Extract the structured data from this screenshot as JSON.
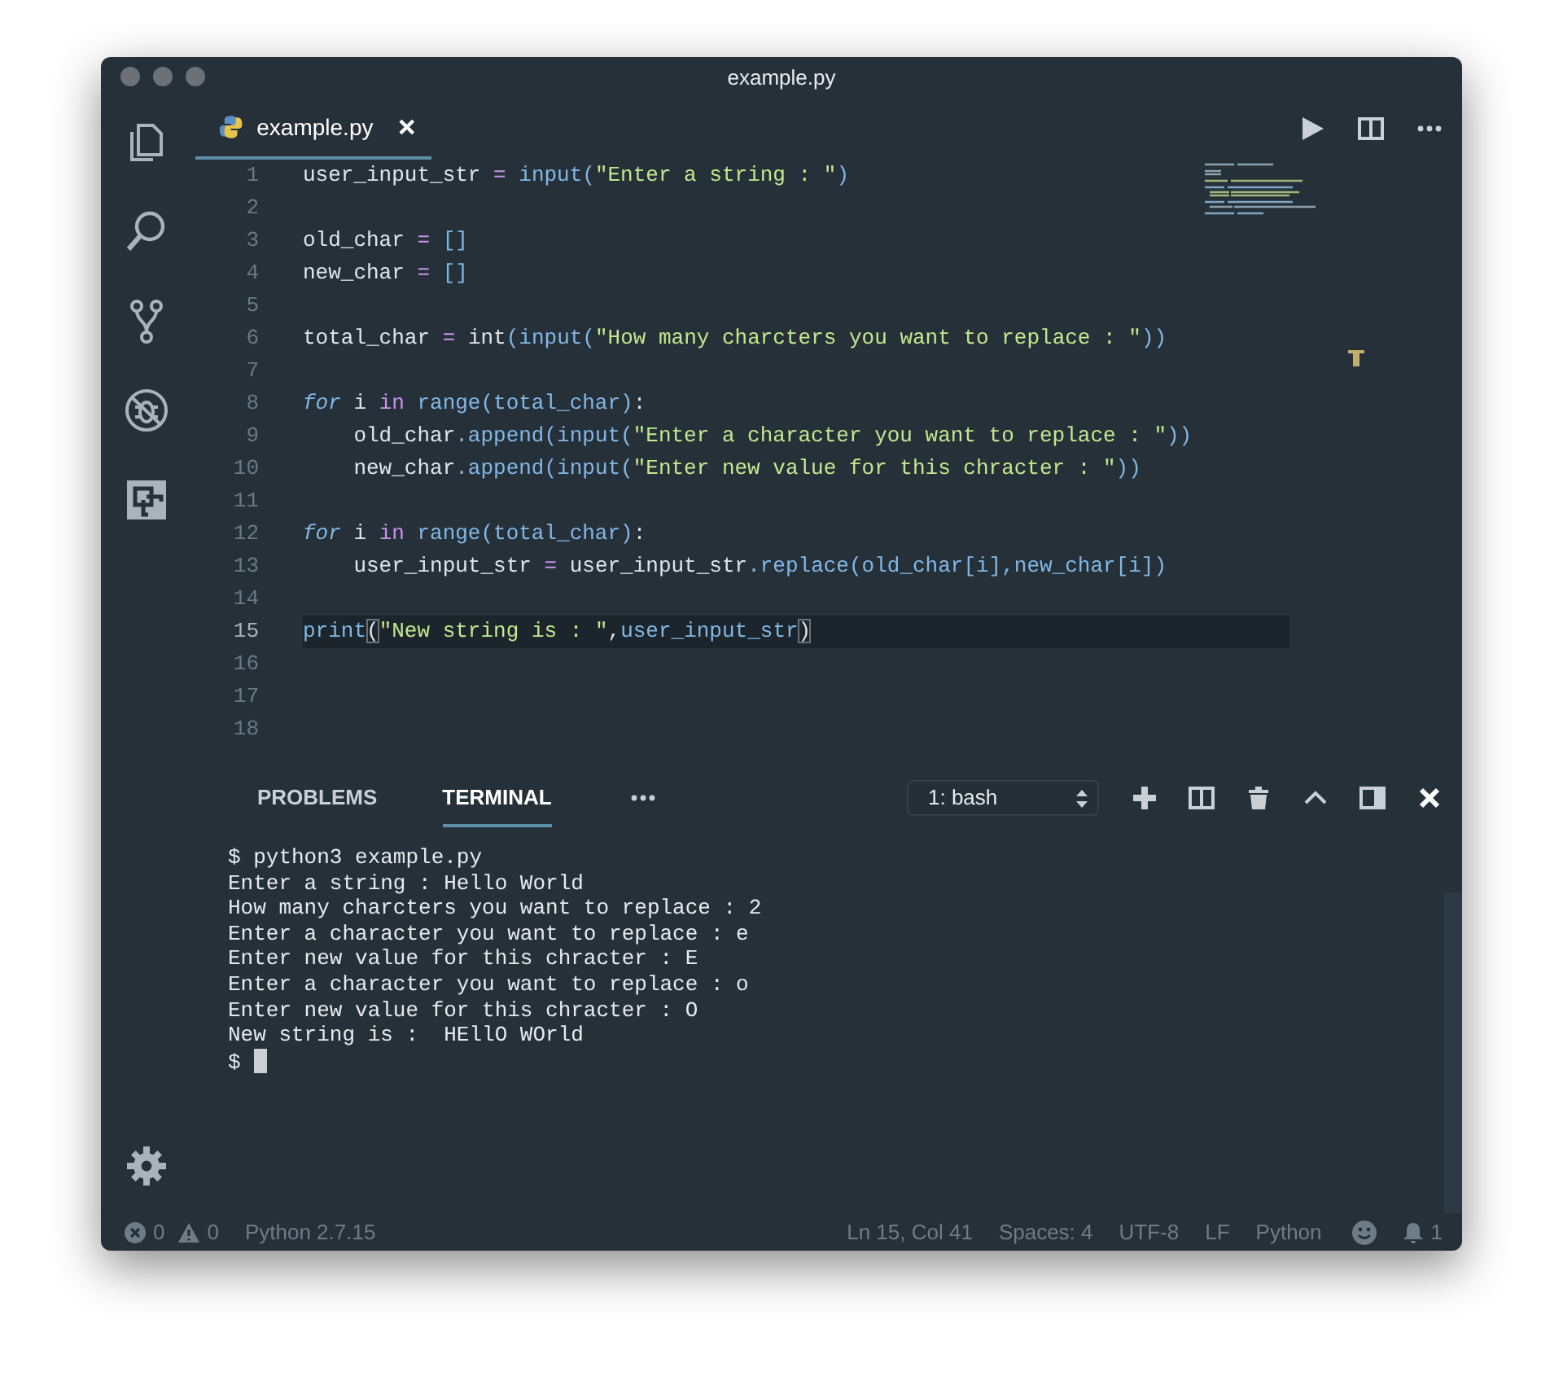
{
  "window": {
    "title": "example.py"
  },
  "tabs": [
    {
      "label": "example.py",
      "selected": true
    }
  ],
  "editor": {
    "lines": [
      {
        "number": "1",
        "current": false,
        "tokens": [
          {
            "text": "user_input_str ",
            "kind": "plain"
          },
          {
            "text": "= ",
            "kind": "operator"
          },
          {
            "text": "input(",
            "kind": "func"
          },
          {
            "text": "\"Enter a string : \"",
            "kind": "string"
          },
          {
            "text": ")",
            "kind": "func"
          }
        ]
      },
      {
        "number": "2",
        "current": false
      },
      {
        "number": "3",
        "current": false,
        "tokens": [
          {
            "text": "old_char ",
            "kind": "plain"
          },
          {
            "text": "= ",
            "kind": "operator"
          },
          {
            "text": "[]",
            "kind": "punct"
          }
        ]
      },
      {
        "number": "4",
        "current": false,
        "tokens": [
          {
            "text": "new_char ",
            "kind": "plain"
          },
          {
            "text": "= ",
            "kind": "operator"
          },
          {
            "text": "[]",
            "kind": "punct"
          }
        ]
      },
      {
        "number": "5",
        "current": false
      },
      {
        "number": "6",
        "current": false,
        "tokens": [
          {
            "text": "total_char ",
            "kind": "plain"
          },
          {
            "text": "=",
            "kind": "operator"
          },
          {
            "text": " int",
            "kind": "plain"
          },
          {
            "text": "(input(",
            "kind": "func"
          },
          {
            "text": "\"How many charcters you want to replace : \"",
            "kind": "string"
          },
          {
            "text": "))",
            "kind": "func"
          }
        ]
      },
      {
        "number": "7",
        "current": false
      },
      {
        "number": "8",
        "current": false,
        "tokens": [
          {
            "text": "for",
            "kind": "keyword"
          },
          {
            "text": " i ",
            "kind": "plain"
          },
          {
            "text": "in ",
            "kind": "operator"
          },
          {
            "text": "range(total_char)",
            "kind": "func"
          },
          {
            "text": ":",
            "kind": "plain"
          }
        ]
      },
      {
        "number": "9",
        "current": false,
        "tokens": [
          {
            "text": "    old_char",
            "kind": "plain"
          },
          {
            "text": ".append(input(",
            "kind": "func"
          },
          {
            "text": "\"Enter a character you want to replace : \"",
            "kind": "string"
          },
          {
            "text": "))",
            "kind": "func"
          }
        ]
      },
      {
        "number": "10",
        "current": false,
        "tokens": [
          {
            "text": "    new_char",
            "kind": "plain"
          },
          {
            "text": ".append(input(",
            "kind": "func"
          },
          {
            "text": "\"Enter new value for this chracter : \"",
            "kind": "string"
          },
          {
            "text": "))",
            "kind": "func"
          }
        ]
      },
      {
        "number": "11",
        "current": false
      },
      {
        "number": "12",
        "current": false,
        "tokens": [
          {
            "text": "for",
            "kind": "keyword"
          },
          {
            "text": " i ",
            "kind": "plain"
          },
          {
            "text": "in ",
            "kind": "operator"
          },
          {
            "text": "range(total_char)",
            "kind": "func"
          },
          {
            "text": ":",
            "kind": "plain"
          }
        ]
      },
      {
        "number": "13",
        "current": false,
        "tokens": [
          {
            "text": "    user_input_str ",
            "kind": "plain"
          },
          {
            "text": "=",
            "kind": "operator"
          },
          {
            "text": " user_input_str",
            "kind": "plain"
          },
          {
            "text": ".replace(old_char[i],new_char[i])",
            "kind": "func"
          }
        ]
      },
      {
        "number": "14",
        "current": false
      },
      {
        "number": "15",
        "current": true,
        "tokens": [
          {
            "text": "print",
            "kind": "func"
          },
          {
            "text": "(",
            "kind": "match"
          },
          {
            "text": "\"New string is : \"",
            "kind": "string"
          },
          {
            "text": ",",
            "kind": "plain"
          },
          {
            "text": "user_input_str",
            "kind": "func"
          },
          {
            "text": ")",
            "kind": "match"
          }
        ]
      },
      {
        "number": "16",
        "current": false
      },
      {
        "number": "17",
        "current": false
      },
      {
        "number": "18",
        "current": false
      }
    ]
  },
  "panel": {
    "tabs": [
      {
        "label": "PROBLEMS",
        "selected": false
      },
      {
        "label": "TERMINAL",
        "selected": true
      }
    ],
    "terminal_selector": {
      "value": "1: bash"
    },
    "terminal": {
      "lines": [
        "$ python3 example.py",
        "Enter a string : Hello World",
        "How many charcters you want to replace : 2",
        "Enter a character you want to replace : e",
        "Enter new value for this chracter : E",
        "Enter a character you want to replace : o",
        "Enter new value for this chracter : O",
        "New string is :  HEllO WOrld",
        "$"
      ],
      "cursor_visible": true
    }
  },
  "status_bar": {
    "errors": "0",
    "warnings": "0",
    "interpreter": "Python 2.7.15",
    "position": "Ln 15, Col 41",
    "indentation": "Spaces: 4",
    "encoding": "UTF-8",
    "line_ending": "LF",
    "language": "Python",
    "notifications": "1"
  }
}
